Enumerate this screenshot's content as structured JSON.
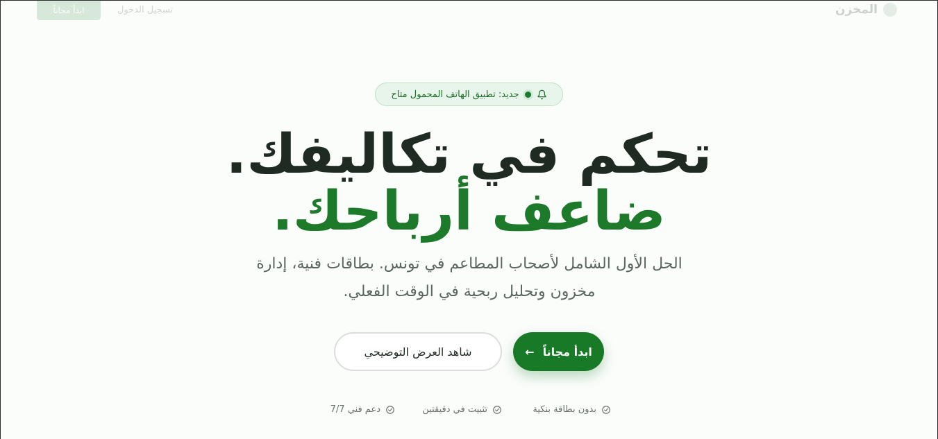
{
  "header": {
    "brand": "المخزن",
    "login": "تسجيل الدخول",
    "cta": "ابدأ مجاناً"
  },
  "badge": {
    "text": "جديد: تطبيق الهاتف المحمول متاح"
  },
  "hero": {
    "line1": "تحكم في تكاليفك.",
    "line2": "ضاعف أرباحك.",
    "subtitle": "الحل الأول الشامل لأصحاب المطاعم في تونس. بطاقات فنية، إدارة مخزون وتحليل ربحية في الوقت الفعلي."
  },
  "buttons": {
    "primary": "ابدأ مجاناً",
    "primary_icon": "arrow-left-icon",
    "secondary": "شاهد العرض التوضيحي"
  },
  "features": [
    {
      "label": "بدون بطاقة بنكية",
      "icon": "check-circle-icon"
    },
    {
      "label": "تثبيت في دقيقتين",
      "icon": "check-circle-icon"
    },
    {
      "label": "دعم فني 7/7",
      "icon": "check-circle-icon"
    }
  ],
  "colors": {
    "accent": "#187a26",
    "headline": "#1f2a22",
    "badge_bg": "#e8f5ea"
  }
}
